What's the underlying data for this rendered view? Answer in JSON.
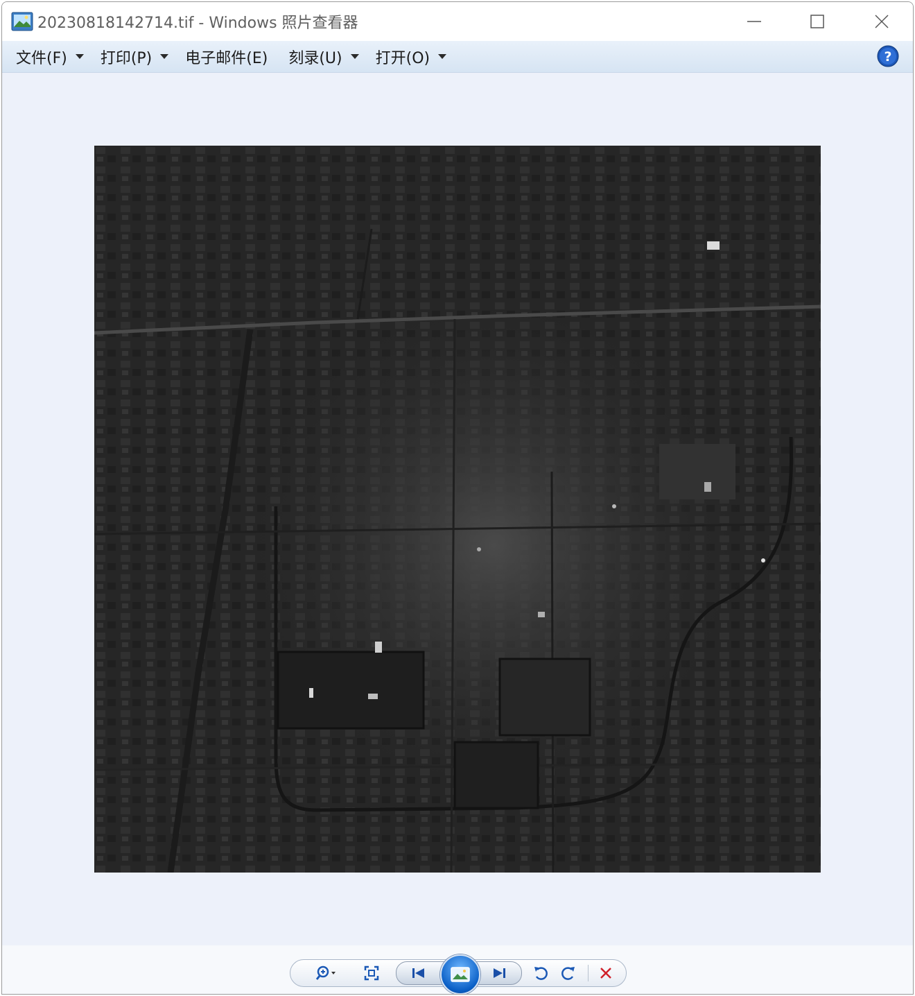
{
  "window": {
    "title": "20230818142714.tif - Windows 照片查看器",
    "controls": [
      "minimize-icon",
      "maximize-icon",
      "close-icon"
    ]
  },
  "menu": {
    "items": [
      {
        "label": "文件(F)",
        "has_dropdown": true
      },
      {
        "label": "打印(P)",
        "has_dropdown": true
      },
      {
        "label": "电子邮件(E)",
        "has_dropdown": false
      },
      {
        "label": "刻录(U)",
        "has_dropdown": true
      },
      {
        "label": "打开(O)",
        "has_dropdown": true
      }
    ],
    "help_icon": "help-icon"
  },
  "viewer": {
    "image": "grayscale satellite image",
    "background": "#edf1fa"
  },
  "toolbar": {
    "buttons": [
      "zoom-icon",
      "actual-size-icon",
      "previous-icon",
      "slideshow-icon",
      "next-icon",
      "rotate-counterclockwise-icon",
      "rotate-clockwise-icon",
      "delete-icon"
    ]
  },
  "colors": {
    "accent": "#1a6fd8",
    "delete": "#d0202a",
    "menubar": "#dde8f5"
  }
}
